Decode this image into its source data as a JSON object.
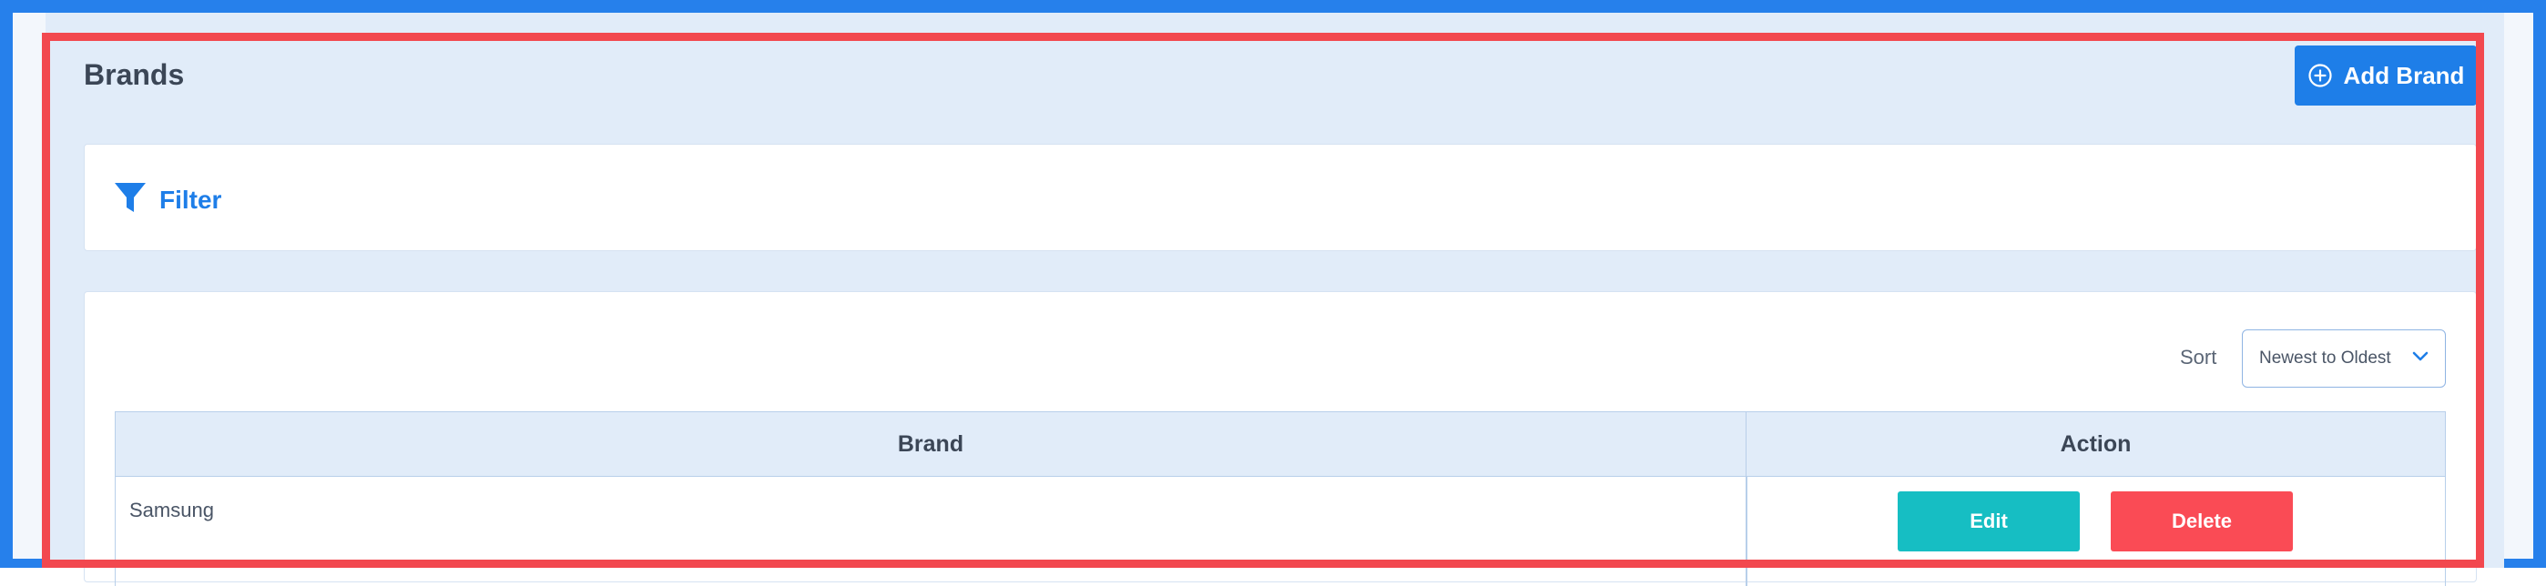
{
  "page": {
    "title": "Brands"
  },
  "toolbar": {
    "add_label": "Add Brand",
    "add_icon": "plus-circle-icon"
  },
  "filter": {
    "label": "Filter",
    "icon": "funnel-icon"
  },
  "sort": {
    "label": "Sort",
    "selected": "Newest to Oldest",
    "icon": "chevron-down-icon"
  },
  "table": {
    "headers": {
      "brand": "Brand",
      "action": "Action"
    },
    "rows": [
      {
        "brand": "Samsung",
        "edit_label": "Edit",
        "delete_label": "Delete"
      }
    ]
  },
  "colors": {
    "primary": "#1e7ee8",
    "edit": "#16bec3",
    "delete": "#fa4b55",
    "frame_blue": "#2680eb",
    "frame_red": "#f2484f",
    "header_bg": "#e1ecf9"
  }
}
